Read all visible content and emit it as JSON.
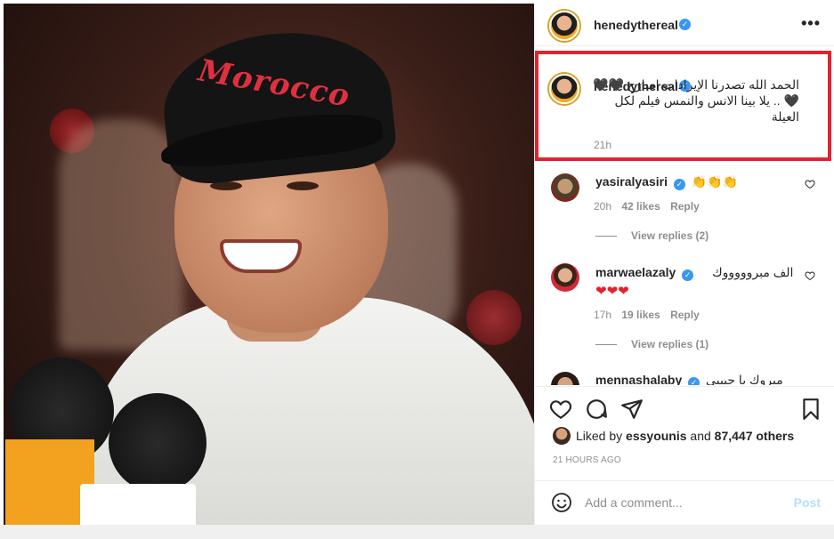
{
  "post": {
    "username": "henedythereal",
    "more_icon": "more-horizontal-icon"
  },
  "caption": {
    "username": "henedythereal",
    "text": "الحمد الله تصدرنا الإيرادات امبارح 🖤🖤🖤 .. يلا بينا الانس والنمس فيلم لكل العيلة",
    "time": "21h"
  },
  "comments": [
    {
      "username": "yasiralyasiri",
      "text": "👏👏👏",
      "time": "20h",
      "likes": "42 likes",
      "reply": "Reply",
      "view_replies": "View replies (2)"
    },
    {
      "username": "marwaelazaly",
      "text": "الف مبروووووك",
      "text2": "❤❤❤",
      "time": "17h",
      "likes": "19 likes",
      "reply": "Reply",
      "view_replies": "View replies (1)"
    },
    {
      "username": "mennashalaby",
      "text": "مبروك يا حبيبي"
    }
  ],
  "actions": {
    "like_icon": "heart-icon",
    "comment_icon": "comment-icon",
    "share_icon": "share-icon",
    "save_icon": "bookmark-icon"
  },
  "likes": {
    "prefix": "Liked by",
    "user": "essyounis",
    "joiner": "and",
    "others": "87,447 others"
  },
  "posted_time": "21 HOURS AGO",
  "add_comment": {
    "placeholder": "Add a comment...",
    "post_label": "Post"
  },
  "photo": {
    "cap_text": "Morocco"
  },
  "colors": {
    "verified": "#3897f0",
    "highlight_border": "#e0232e",
    "post_button_disabled": "#b2dffc"
  }
}
